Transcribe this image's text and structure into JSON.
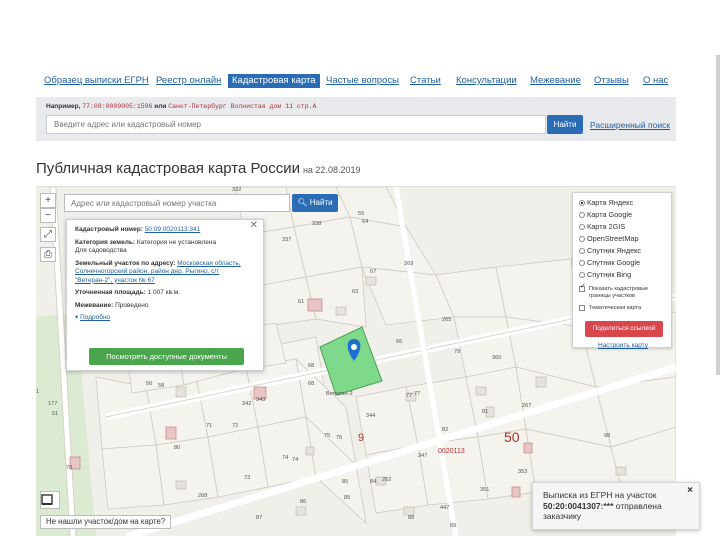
{
  "nav": {
    "items": [
      {
        "label": "Образец выписки ЕГРН",
        "active": false
      },
      {
        "label": "Реестр онлайн",
        "active": false
      },
      {
        "label": "Кадастровая карта",
        "active": true
      },
      {
        "label": "Частые вопросы",
        "active": false
      },
      {
        "label": "Статьи",
        "active": false
      },
      {
        "label": "Консультации",
        "active": false
      },
      {
        "label": "Межевание",
        "active": false
      },
      {
        "label": "Отзывы",
        "active": false
      },
      {
        "label": "О нас",
        "active": false
      }
    ]
  },
  "search": {
    "example_prefix": "Например,",
    "example_number": "77:08:0009005:1596",
    "example_or": "или",
    "example_address": "Санкт-Петербург Волнистая дом 11 стр.А",
    "placeholder": "Введите адрес или кадастровый номер",
    "button": "Найти",
    "advanced_link": "Расширенный поиск"
  },
  "page": {
    "title": "Публичная кадастровая карта России",
    "date": "на 22.08.2019"
  },
  "map": {
    "search_placeholder": "Адрес или кадастровый номер участка",
    "search_button": "Найти",
    "controls": {
      "zoom_in": "+",
      "zoom_out": "−"
    },
    "not_found": "Не нашли участок/дом на карте?",
    "parcel_labels": [
      "332",
      "338",
      "337",
      "55",
      "64",
      "67",
      "269",
      "63",
      "61",
      "265",
      "66",
      "79",
      "360",
      "68",
      "71",
      "56",
      "58",
      "342",
      "343",
      "344",
      "77",
      "81",
      "267",
      "51",
      "177",
      "1",
      "80",
      "71",
      "72",
      "73",
      "74",
      "75",
      "75",
      "9",
      "82",
      "347",
      "50",
      "353",
      "98",
      "70",
      "84",
      "85",
      "262",
      "351",
      "268",
      "86",
      "85",
      "88",
      "87",
      "447",
      "89",
      "0020113",
      "Ветеран-2"
    ],
    "big_label_a": "9",
    "big_label_b": "50",
    "parcel_text": "0020113"
  },
  "info": {
    "cad_label": "Кадастровый номер:",
    "cad_value": "50:09:0020113:341",
    "cat_label": "Категория земель:",
    "cat_value": "Категория не установлена",
    "cat_value2": "Для садоводства",
    "addr_label": "Земельный участок по адресу:",
    "addr_value": "Московская область, Солнечногорский район, район дер. Рыгино, с/т \"Ветеран-2\", участок № 67",
    "area_label": "Уточненная площадь:",
    "area_value": "1 007 кв.м.",
    "survey_label": "Межевание:",
    "survey_value": "Проведено",
    "more": "Подробно",
    "docs_button": "Посмотреть доступные документы"
  },
  "layers": {
    "options": [
      {
        "label": "Карта Яндекс",
        "selected": true
      },
      {
        "label": "Карта Google",
        "selected": false
      },
      {
        "label": "Карта 2GIS",
        "selected": false
      },
      {
        "label": "OpenStreetMap",
        "selected": false
      },
      {
        "label": "Спутник Яндекс",
        "selected": false
      },
      {
        "label": "Спутник Google",
        "selected": false
      },
      {
        "label": "Спутник Bing",
        "selected": false
      }
    ],
    "show_borders": "Показать кадастровые границы участков",
    "thematic": "Тематическая карта",
    "share_button": "Поделиться ссылкой",
    "setup_link": "Настроить карту"
  },
  "toast": {
    "line1": "Выписка из ЕГРН на участок",
    "number": "50:20:0041307:***",
    "line2": "отправлена",
    "line3": "заказчику",
    "close": "×"
  },
  "colors": {
    "accent": "#2a6db5",
    "green_parcel": "#7fd98b",
    "red_button": "#d9464c",
    "green_button": "#4aa64c"
  }
}
